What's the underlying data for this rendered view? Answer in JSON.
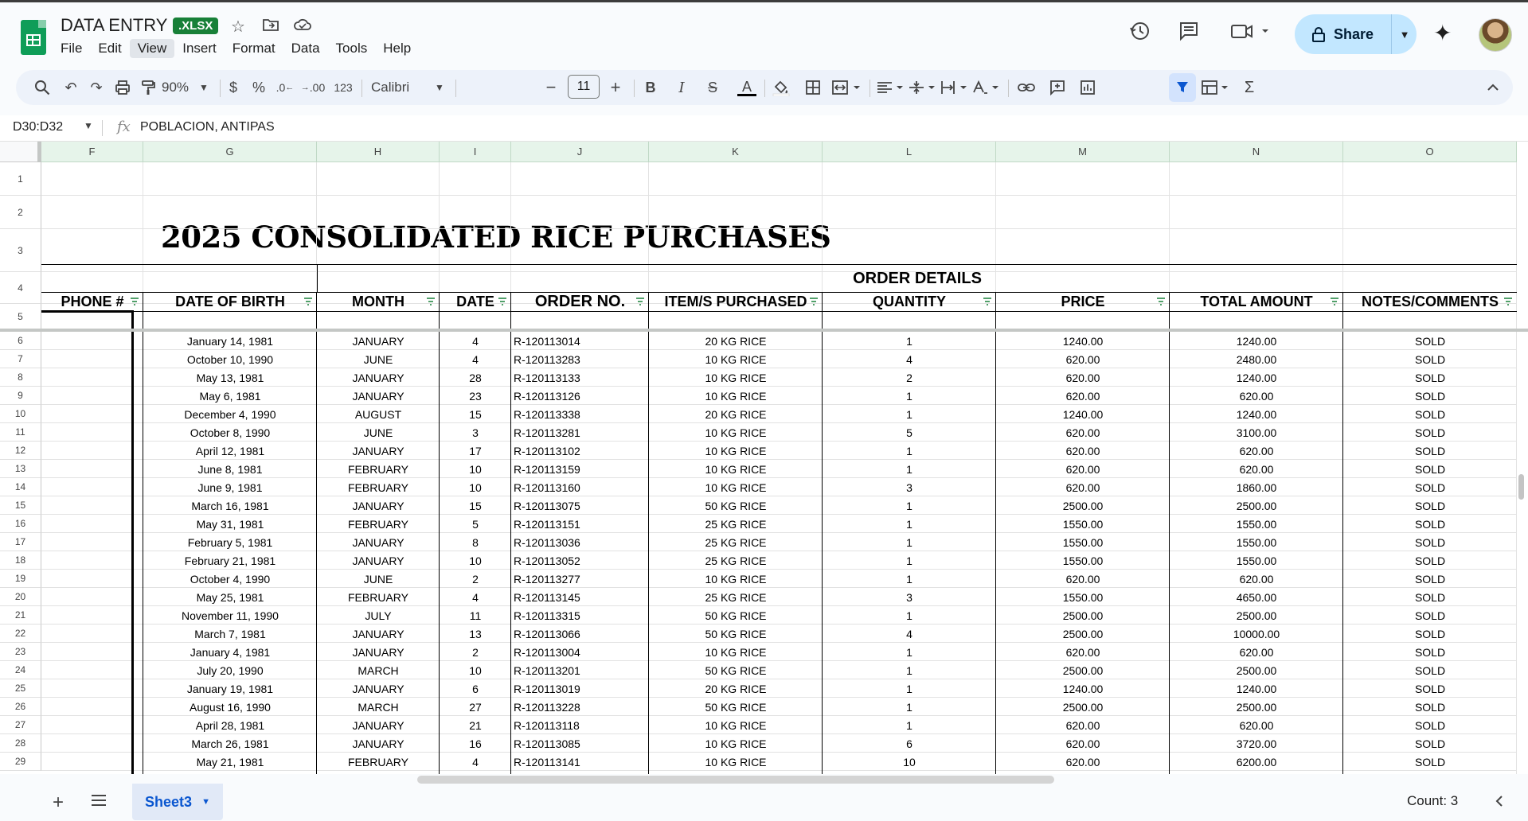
{
  "app": {
    "doc_title": "DATA ENTRY",
    "badge": ".XLSX",
    "menu": [
      "File",
      "Edit",
      "View",
      "Insert",
      "Format",
      "Data",
      "Tools",
      "Help"
    ],
    "active_menu": "View",
    "share_label": "Share"
  },
  "toolbar": {
    "zoom": "90%",
    "currency": "$",
    "percent": "%",
    "dec_decrease": ".0",
    "dec_increase": ".00",
    "number_format": "123",
    "font": "Calibri",
    "font_size": "11"
  },
  "formula_bar": {
    "cell_ref": "D30:D32",
    "fx": "fx",
    "content": "POBLACION, ANTIPAS"
  },
  "columns": [
    "F",
    "G",
    "H",
    "I",
    "J",
    "K",
    "L",
    "M",
    "N",
    "O"
  ],
  "row_numbers": [
    "1",
    "2",
    "3",
    "4",
    "5",
    "6",
    "7",
    "8",
    "9",
    "10",
    "11",
    "12",
    "13",
    "14",
    "15",
    "16",
    "17",
    "18",
    "19",
    "20",
    "21",
    "22",
    "23",
    "24",
    "25",
    "26",
    "27",
    "28",
    "29"
  ],
  "sheet": {
    "title": "2025 CONSOLIDATED RICE PURCHASES",
    "group_header": "ORDER DETAILS",
    "headers": [
      "PHONE #",
      "DATE OF BIRTH",
      "MONTH",
      "DATE",
      "ORDER NO.",
      "ITEM/S PURCHASED",
      "QUANTITY",
      "PRICE",
      "TOTAL AMOUNT",
      "NOTES/COMMENTS"
    ],
    "rows": [
      [
        "January 14, 1981",
        "JANUARY",
        "4",
        "R-120113014",
        "20 KG RICE",
        "1",
        "1240.00",
        "1240.00",
        "SOLD"
      ],
      [
        "October 10, 1990",
        "JUNE",
        "4",
        "R-120113283",
        "10 KG RICE",
        "4",
        "620.00",
        "2480.00",
        "SOLD"
      ],
      [
        "May 13, 1981",
        "JANUARY",
        "28",
        "R-120113133",
        "10 KG RICE",
        "2",
        "620.00",
        "1240.00",
        "SOLD"
      ],
      [
        "May 6, 1981",
        "JANUARY",
        "23",
        "R-120113126",
        "10 KG RICE",
        "1",
        "620.00",
        "620.00",
        "SOLD"
      ],
      [
        "December 4, 1990",
        "AUGUST",
        "15",
        "R-120113338",
        "20 KG RICE",
        "1",
        "1240.00",
        "1240.00",
        "SOLD"
      ],
      [
        "October 8, 1990",
        "JUNE",
        "3",
        "R-120113281",
        "10 KG RICE",
        "5",
        "620.00",
        "3100.00",
        "SOLD"
      ],
      [
        "April 12, 1981",
        "JANUARY",
        "17",
        "R-120113102",
        "10 KG RICE",
        "1",
        "620.00",
        "620.00",
        "SOLD"
      ],
      [
        "June 8, 1981",
        "FEBRUARY",
        "10",
        "R-120113159",
        "10 KG RICE",
        "1",
        "620.00",
        "620.00",
        "SOLD"
      ],
      [
        "June 9, 1981",
        "FEBRUARY",
        "10",
        "R-120113160",
        "10 KG RICE",
        "3",
        "620.00",
        "1860.00",
        "SOLD"
      ],
      [
        "March 16, 1981",
        "JANUARY",
        "15",
        "R-120113075",
        "50 KG RICE",
        "1",
        "2500.00",
        "2500.00",
        "SOLD"
      ],
      [
        "May 31, 1981",
        "FEBRUARY",
        "5",
        "R-120113151",
        "25 KG RICE",
        "1",
        "1550.00",
        "1550.00",
        "SOLD"
      ],
      [
        "February 5, 1981",
        "JANUARY",
        "8",
        "R-120113036",
        "25 KG RICE",
        "1",
        "1550.00",
        "1550.00",
        "SOLD"
      ],
      [
        "February 21, 1981",
        "JANUARY",
        "10",
        "R-120113052",
        "25 KG RICE",
        "1",
        "1550.00",
        "1550.00",
        "SOLD"
      ],
      [
        "October 4, 1990",
        "JUNE",
        "2",
        "R-120113277",
        "10 KG RICE",
        "1",
        "620.00",
        "620.00",
        "SOLD"
      ],
      [
        "May 25, 1981",
        "FEBRUARY",
        "4",
        "R-120113145",
        "25 KG RICE",
        "3",
        "1550.00",
        "4650.00",
        "SOLD"
      ],
      [
        "November 11, 1990",
        "JULY",
        "11",
        "R-120113315",
        "50 KG RICE",
        "1",
        "2500.00",
        "2500.00",
        "SOLD"
      ],
      [
        "March 7, 1981",
        "JANUARY",
        "13",
        "R-120113066",
        "50 KG RICE",
        "4",
        "2500.00",
        "10000.00",
        "SOLD"
      ],
      [
        "January 4, 1981",
        "JANUARY",
        "2",
        "R-120113004",
        "10 KG RICE",
        "1",
        "620.00",
        "620.00",
        "SOLD"
      ],
      [
        "July 20, 1990",
        "MARCH",
        "10",
        "R-120113201",
        "50 KG RICE",
        "1",
        "2500.00",
        "2500.00",
        "SOLD"
      ],
      [
        "January 19, 1981",
        "JANUARY",
        "6",
        "R-120113019",
        "20 KG RICE",
        "1",
        "1240.00",
        "1240.00",
        "SOLD"
      ],
      [
        "August 16, 1990",
        "MARCH",
        "27",
        "R-120113228",
        "50 KG RICE",
        "1",
        "2500.00",
        "2500.00",
        "SOLD"
      ],
      [
        "April 28, 1981",
        "JANUARY",
        "21",
        "R-120113118",
        "10 KG RICE",
        "1",
        "620.00",
        "620.00",
        "SOLD"
      ],
      [
        "March 26, 1981",
        "JANUARY",
        "16",
        "R-120113085",
        "10 KG RICE",
        "6",
        "620.00",
        "3720.00",
        "SOLD"
      ],
      [
        "May 21, 1981",
        "FEBRUARY",
        "4",
        "R-120113141",
        "10 KG RICE",
        "10",
        "620.00",
        "6200.00",
        "SOLD"
      ]
    ]
  },
  "bottom": {
    "add": "+",
    "sheet_tab": "Sheet3",
    "count": "Count: 3"
  },
  "colors": {
    "accent": "#0b57d0",
    "share_bg": "#c2e7ff",
    "header_bg": "#e6f4ea",
    "xlsx_badge": "#188038"
  }
}
